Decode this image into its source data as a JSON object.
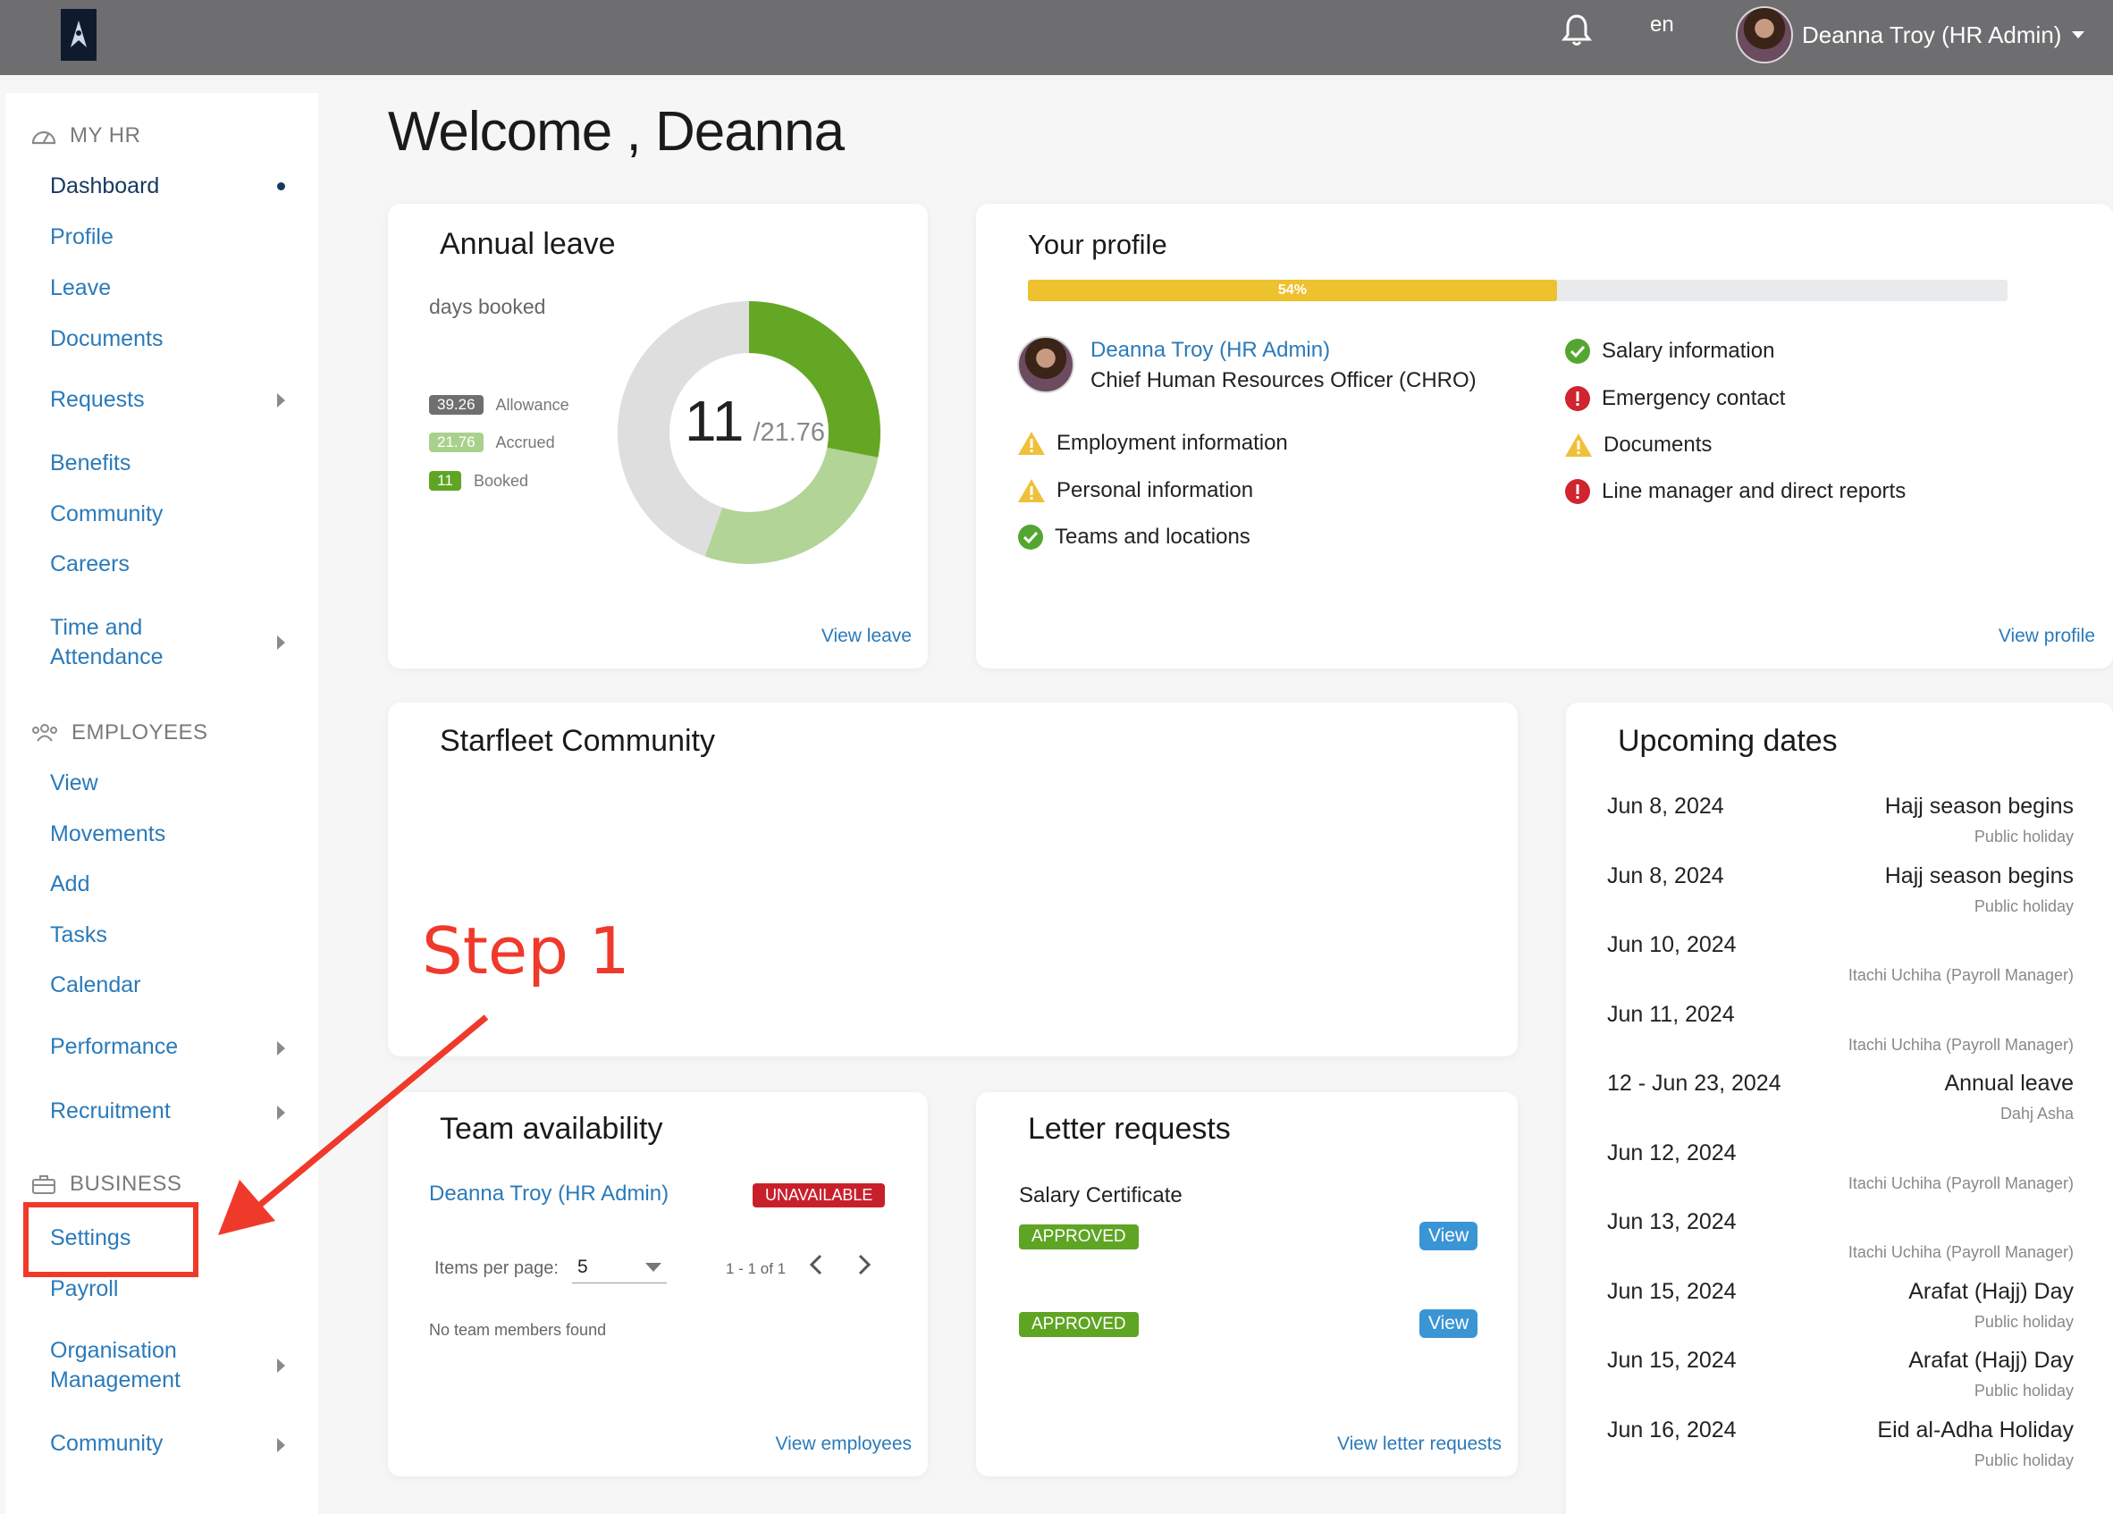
{
  "topbar": {
    "language": "en",
    "user_name": "Deanna Troy (HR Admin)",
    "icons": [
      "starfleet-logo-icon",
      "bell-icon",
      "chevron-down-icon"
    ]
  },
  "sidebar": {
    "my_hr_header": "MY HR",
    "my_hr_items": [
      "Dashboard",
      "Profile",
      "Leave",
      "Documents",
      "Requests",
      "Benefits",
      "Community",
      "Careers",
      "Time and Attendance"
    ],
    "employees_header": "EMPLOYEES",
    "employees_items": [
      "View",
      "Movements",
      "Add",
      "Tasks",
      "Calendar",
      "Performance",
      "Recruitment"
    ],
    "business_header": "BUSINESS",
    "business_items": [
      "Settings",
      "Payroll",
      "Organisation Management",
      "Community"
    ]
  },
  "main": {
    "welcome": "Welcome , Deanna"
  },
  "annual_leave": {
    "title": "Annual leave",
    "subtitle": "days booked",
    "legend": [
      {
        "value": "39.26",
        "label": "Allowance",
        "color": "#6f6f6f"
      },
      {
        "value": "21.76",
        "label": "Accrued",
        "color": "#a9d18e"
      },
      {
        "value": "11",
        "label": "Booked",
        "color": "#5fa524"
      }
    ],
    "center_value": "11",
    "center_total": "/21.76",
    "booked": 11,
    "accrued": 21.76,
    "allowance": 39.26,
    "link": "View leave"
  },
  "profile": {
    "title": "Your profile",
    "progress_label": "54%",
    "progress": 54,
    "name": "Deanna Troy (HR Admin)",
    "role": "Chief Human Resources Officer (CHRO)",
    "left_items": [
      {
        "label": "Employment information",
        "status": "warning"
      },
      {
        "label": "Personal information",
        "status": "warning"
      },
      {
        "label": "Teams and locations",
        "status": "ok"
      }
    ],
    "right_items": [
      {
        "label": "Salary information",
        "status": "ok"
      },
      {
        "label": "Emergency contact",
        "status": "error"
      },
      {
        "label": "Documents",
        "status": "warning"
      },
      {
        "label": "Line manager and direct reports",
        "status": "error"
      }
    ],
    "link": "View profile"
  },
  "community": {
    "title": "Starfleet Community"
  },
  "annotation": {
    "step_label": "Step 1",
    "color": "#ef3a2b"
  },
  "team": {
    "title": "Team availability",
    "member": "Deanna Troy (HR Admin)",
    "status": "UNAVAILABLE",
    "items_per_page_label": "Items per page:",
    "items_per_page": "5",
    "range": "1 - 1 of 1",
    "empty": "No team members found",
    "link": "View employees"
  },
  "letters": {
    "title": "Letter requests",
    "items": [
      {
        "name": "Salary Certificate",
        "status": "APPROVED",
        "action": "View"
      },
      {
        "name": "",
        "status": "APPROVED",
        "action": "View"
      }
    ],
    "link": "View letter requests"
  },
  "upcoming": {
    "title": "Upcoming dates",
    "items": [
      {
        "date": "Jun 8, 2024",
        "name": "Hajj season begins",
        "sub": "Public holiday"
      },
      {
        "date": "Jun 8, 2024",
        "name": "Hajj season begins",
        "sub": "Public holiday"
      },
      {
        "date": "Jun 10, 2024",
        "name": "",
        "sub": "Itachi Uchiha (Payroll Manager)"
      },
      {
        "date": "Jun 11, 2024",
        "name": "",
        "sub": "Itachi Uchiha (Payroll Manager)"
      },
      {
        "date": "12 - Jun 23, 2024",
        "name": "Annual leave",
        "sub": "Dahj Asha"
      },
      {
        "date": "Jun 12, 2024",
        "name": "",
        "sub": "Itachi Uchiha (Payroll Manager)"
      },
      {
        "date": "Jun 13, 2024",
        "name": "",
        "sub": "Itachi Uchiha (Payroll Manager)"
      },
      {
        "date": "Jun 15, 2024",
        "name": "Arafat (Hajj) Day",
        "sub": "Public holiday"
      },
      {
        "date": "Jun 15, 2024",
        "name": "Arafat (Hajj) Day",
        "sub": "Public holiday"
      },
      {
        "date": "Jun 16, 2024",
        "name": "Eid al-Adha Holiday",
        "sub": "Public holiday"
      }
    ]
  }
}
